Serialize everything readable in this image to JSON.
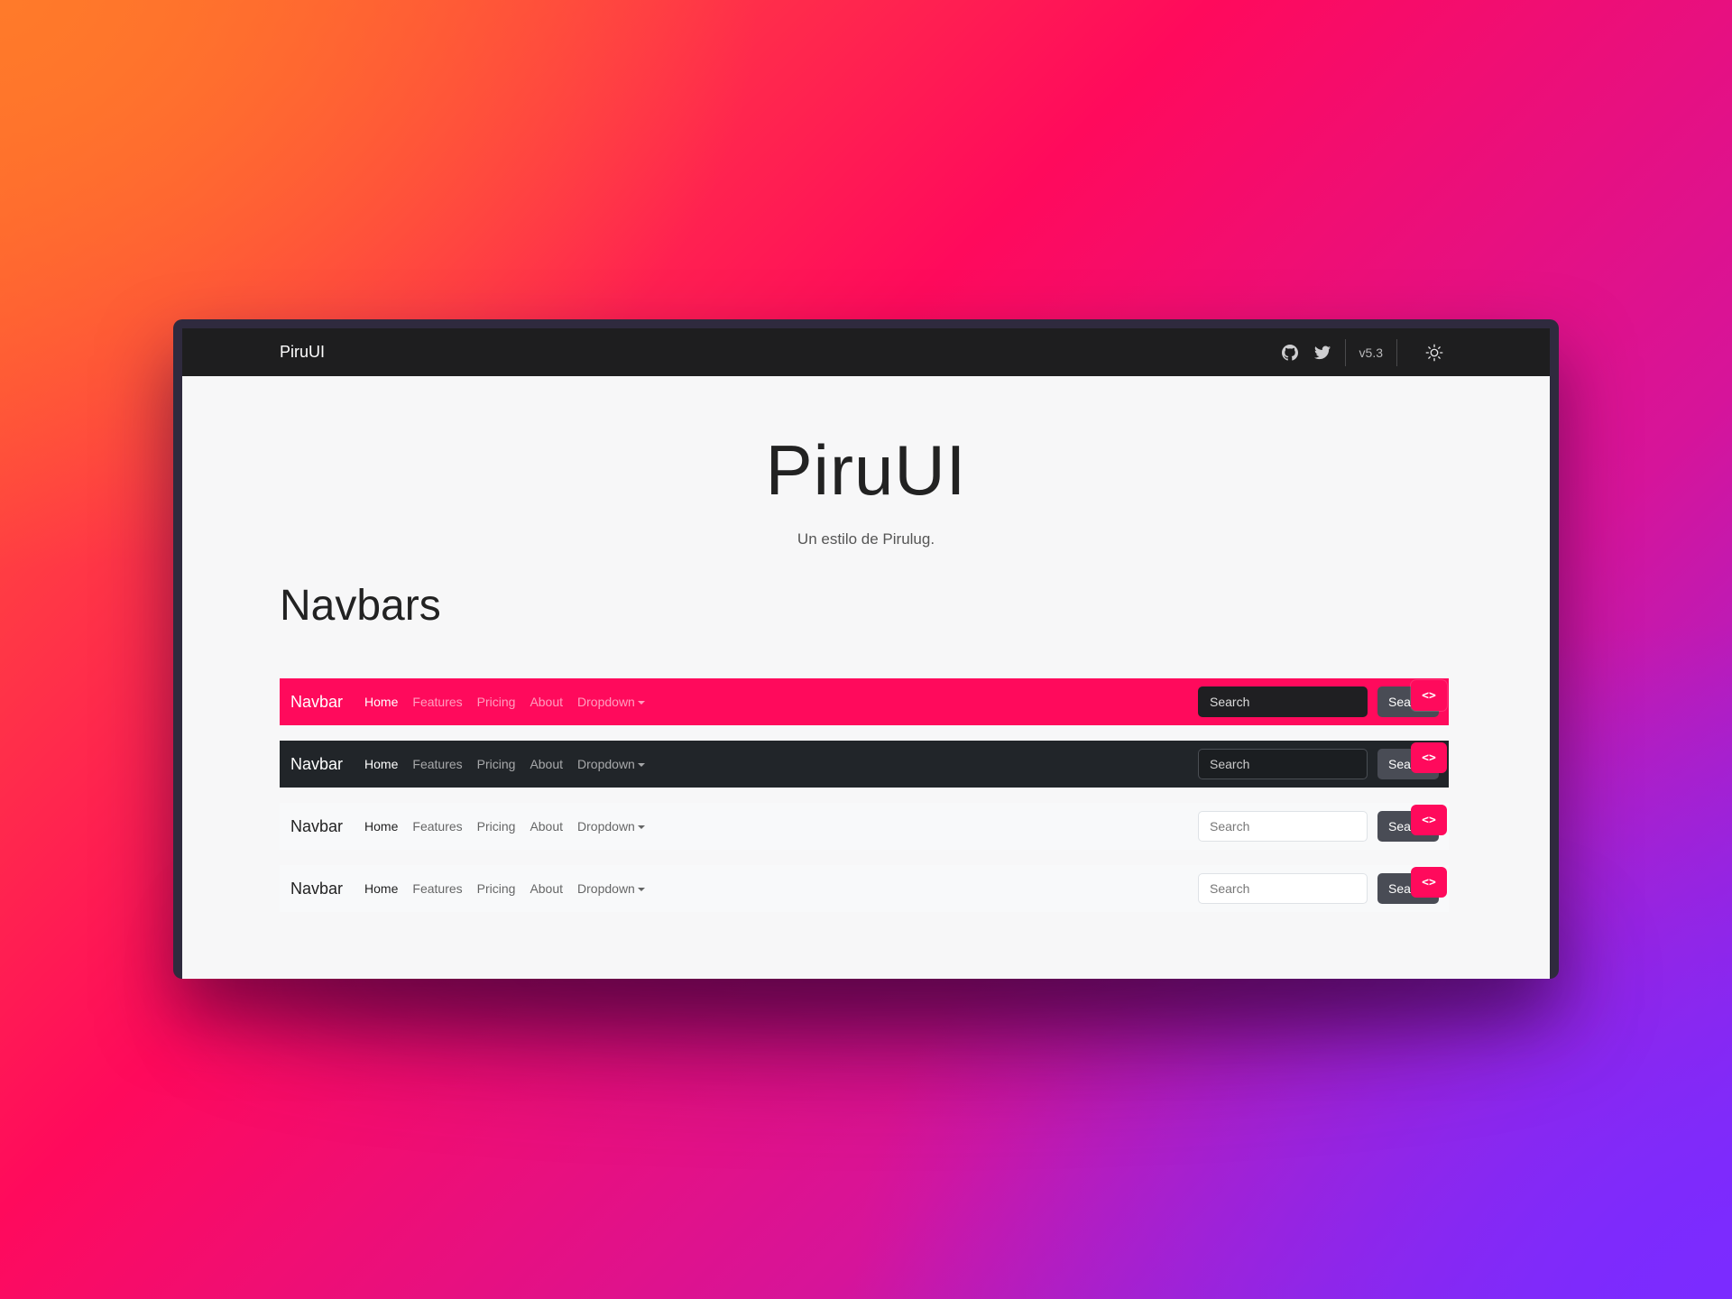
{
  "app": {
    "brand": "PiruUI",
    "version": "v5.3",
    "icons": {
      "github": "github-icon",
      "twitter": "twitter-icon",
      "theme": "sun-icon"
    }
  },
  "hero": {
    "title": "PiruUI",
    "subtitle": "Un estilo de Pirulug."
  },
  "section": {
    "title": "Navbars"
  },
  "navbars": [
    {
      "variant": "pink",
      "brand": "Navbar",
      "links": [
        "Home",
        "Features",
        "Pricing",
        "About",
        "Dropdown"
      ],
      "search_placeholder": "Search",
      "search_button": "Search",
      "code_button": "<>"
    },
    {
      "variant": "dark",
      "brand": "Navbar",
      "links": [
        "Home",
        "Features",
        "Pricing",
        "About",
        "Dropdown"
      ],
      "search_placeholder": "Search",
      "search_button": "Search",
      "code_button": "<>"
    },
    {
      "variant": "light",
      "brand": "Navbar",
      "links": [
        "Home",
        "Features",
        "Pricing",
        "About",
        "Dropdown"
      ],
      "search_placeholder": "Search",
      "search_button": "Search",
      "code_button": "<>"
    },
    {
      "variant": "light",
      "brand": "Navbar",
      "links": [
        "Home",
        "Features",
        "Pricing",
        "About",
        "Dropdown"
      ],
      "search_placeholder": "Search",
      "search_button": "Search",
      "code_button": "<>"
    }
  ],
  "colors": {
    "accent": "#ff0a5c",
    "dark": "#212529",
    "topbar": "#1e1e1f",
    "light": "#f8f9fa"
  }
}
